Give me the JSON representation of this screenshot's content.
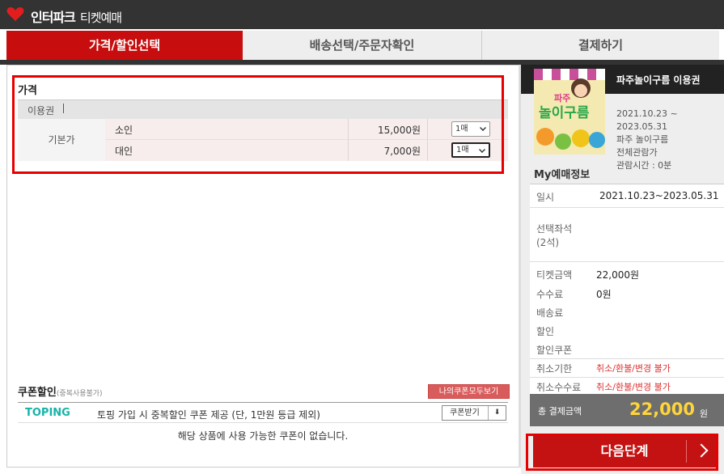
{
  "header": {
    "brand": "인터파크",
    "subtitle": "티켓예매"
  },
  "tabs": [
    {
      "label": "가격/할인선택",
      "active": true
    },
    {
      "label": "배송선택/주문자확인",
      "active": false
    },
    {
      "label": "결제하기",
      "active": false
    }
  ],
  "price": {
    "title": "가격",
    "usage_label": "이용권",
    "base_label": "기본가",
    "rows": [
      {
        "name": "소인",
        "amount": "15,000원",
        "qty": "1매"
      },
      {
        "name": "대인",
        "amount": "7,000원",
        "qty": "1매"
      }
    ]
  },
  "coupon": {
    "title": "쿠폰할인",
    "note": "(중복사용불가)",
    "my_coupon_button": "나의쿠폰모두보기",
    "provider": "TOPING",
    "text": "토핑 가입 시 중복할인 쿠폰 제공 (단, 1만원 등급 제외)",
    "receive_button": "쿠폰받기",
    "empty_message": "해당 상품에 사용 가능한 쿠폰이 없습니다."
  },
  "product": {
    "name": "파주놀이구름 이용권",
    "poster_text_1": "파주",
    "poster_text_2": "놀이구름",
    "period": "2021.10.23 ~",
    "period_end": "2023.05.31",
    "venue": "파주 놀이구름",
    "rating": "전체관람가",
    "duration": "관람시간 : 0분"
  },
  "my_booking": {
    "title": "My예매정보",
    "rows": [
      {
        "label": "일시",
        "value": "2021.10.23~2023.05.31"
      },
      {
        "label": "선택좌석",
        "label2": "(2석)",
        "value": ""
      },
      {
        "label": "티켓금액",
        "value": "22,000원"
      },
      {
        "label": "수수료",
        "value": "0원"
      },
      {
        "label": "배송료",
        "value": ""
      },
      {
        "label": "할인",
        "value": ""
      },
      {
        "label": "할인쿠폰",
        "value": ""
      },
      {
        "label": "취소기한",
        "value": "취소/환불/변경 불가"
      },
      {
        "label": "취소수수료",
        "value": "취소/환불/변경 불가"
      }
    ],
    "total_label": "총 결제금액",
    "total_value": "22,000",
    "total_unit": "원"
  },
  "next_button": "다음단계",
  "colors": {
    "accent": "#c70d0d",
    "highlight_box": "#e60000",
    "total": "#ffd53a",
    "toping": "#16b3a8"
  }
}
